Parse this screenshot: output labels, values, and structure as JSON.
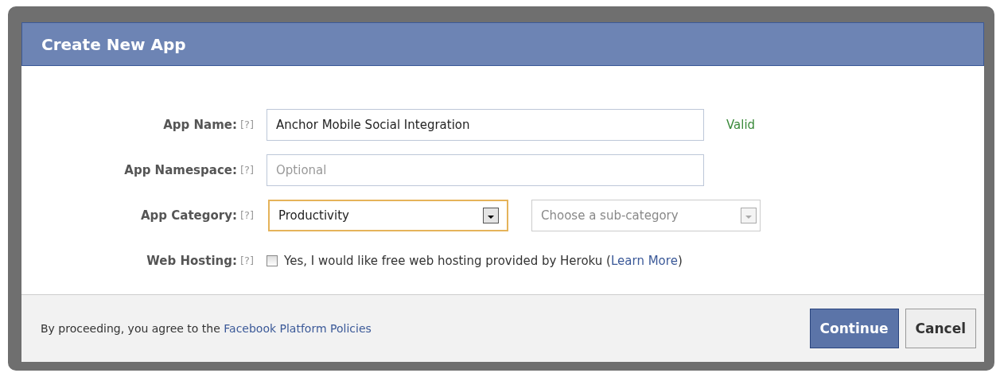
{
  "dialog": {
    "title": "Create New App"
  },
  "fields": [
    {
      "kind": "text",
      "label": "App Name:",
      "help": "[?]",
      "value": "Anchor Mobile Social Integration",
      "status": "Valid"
    },
    {
      "kind": "text",
      "label": "App Namespace:",
      "help": "[?]",
      "placeholder": "Optional"
    },
    {
      "kind": "select",
      "label": "App Category:",
      "help": "[?]",
      "value": "Productivity",
      "focused": true,
      "sub_select": {
        "placeholder": "Choose a sub-category",
        "disabled": true
      }
    },
    {
      "kind": "checkbox",
      "label": "Web Hosting:",
      "help": "[?]",
      "checked": false,
      "text": "Yes, I would like free web hosting provided by Heroku (",
      "link": "Learn More",
      "text_after": ")"
    }
  ],
  "footer": {
    "text": "By proceeding, you agree to the ",
    "link": "Facebook Platform Policies",
    "buttons": [
      {
        "label": "Continue",
        "kind": "primary"
      },
      {
        "label": "Cancel",
        "kind": "secondary"
      }
    ]
  }
}
